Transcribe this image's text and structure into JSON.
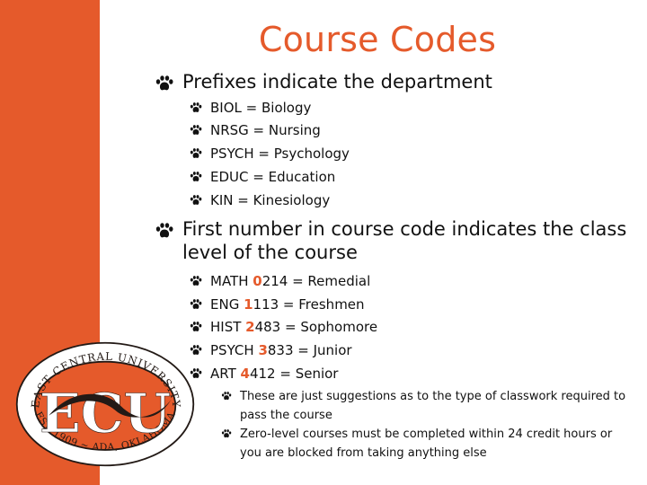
{
  "colors": {
    "accent": "#e55a2b",
    "text": "#111111",
    "background": "#ffffff",
    "logo_dark": "#231a16"
  },
  "slide": {
    "title": "Course Codes",
    "sections": [
      {
        "text": "Prefixes indicate the department",
        "items": [
          {
            "code": "BIOL",
            "meaning": "Biology",
            "text": "BIOL = Biology"
          },
          {
            "code": "NRSG",
            "meaning": "Nursing",
            "text": "NRSG = Nursing"
          },
          {
            "code": "PSYCH",
            "meaning": "Psychology",
            "text": "PSYCH = Psychology"
          },
          {
            "code": "EDUC",
            "meaning": "Education",
            "text": "EDUC = Education"
          },
          {
            "code": "KIN",
            "meaning": "Kinesiology",
            "text": "KIN = Kinesiology"
          }
        ]
      },
      {
        "text_line1": "First number in course code indicates the class",
        "text_line2": "level of the course",
        "items": [
          {
            "prefix": "MATH ",
            "digit": "0",
            "rest": "214 = Remedial"
          },
          {
            "prefix": "ENG ",
            "digit": "1",
            "rest": "113 = Freshmen"
          },
          {
            "prefix": "HIST ",
            "digit": "2",
            "rest": "483 = Sophomore"
          },
          {
            "prefix": "PSYCH ",
            "digit": "3",
            "rest": "833 = Junior"
          },
          {
            "prefix": "ART ",
            "digit": "4",
            "rest": "412 = Senior"
          }
        ],
        "notes": [
          {
            "line1": "These are just suggestions as to the type of classwork required to",
            "line2": "pass the course"
          },
          {
            "line1": "Zero-level courses must be completed within 24 credit hours or",
            "line2": "you are blocked from taking anything else"
          }
        ]
      }
    ]
  },
  "logo": {
    "letters": "ECU",
    "ring_top": "EAST CENTRAL UNIVERSITY",
    "ring_bottom": "EST. 1909 ~ ADA, OKLAHOMA"
  },
  "icons": {
    "bullet": "paw-print-icon"
  }
}
